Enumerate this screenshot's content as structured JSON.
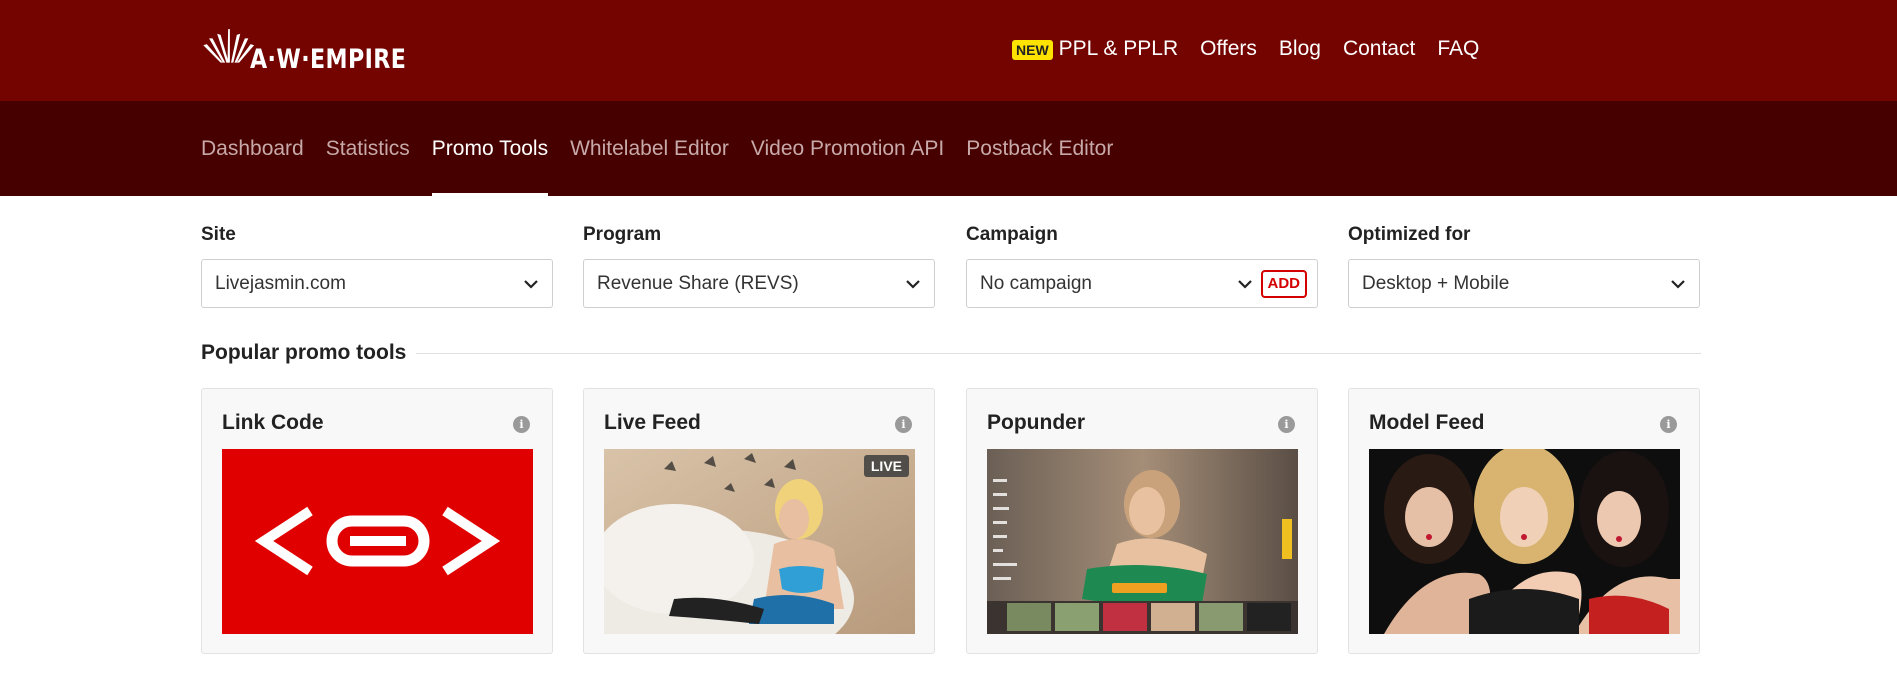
{
  "brand": {
    "logo_text": "A·W·EMPIRE",
    "colors": {
      "header": "#730400",
      "subnav": "#470000",
      "accent": "#d40000",
      "badge": "#ffe300"
    }
  },
  "topnav": {
    "new_badge": "NEW",
    "items": [
      {
        "label": "PPL & PPLR"
      },
      {
        "label": "Offers"
      },
      {
        "label": "Blog"
      },
      {
        "label": "Contact"
      },
      {
        "label": "FAQ"
      }
    ]
  },
  "subnav": {
    "tabs": [
      {
        "label": "Dashboard",
        "active": false
      },
      {
        "label": "Statistics",
        "active": false
      },
      {
        "label": "Promo Tools",
        "active": true
      },
      {
        "label": "Whitelabel Editor",
        "active": false
      },
      {
        "label": "Video Promotion API",
        "active": false
      },
      {
        "label": "Postback Editor",
        "active": false
      }
    ]
  },
  "filters": {
    "site": {
      "label": "Site",
      "value": "Livejasmin.com"
    },
    "program": {
      "label": "Program",
      "value": "Revenue Share (REVS)"
    },
    "campaign": {
      "label": "Campaign",
      "value": "No campaign",
      "add_label": "ADD"
    },
    "optimized": {
      "label": "Optimized for",
      "value": "Desktop + Mobile"
    }
  },
  "section": {
    "title": "Popular promo tools"
  },
  "cards": [
    {
      "title": "Link Code",
      "info": "i",
      "icon": "link-code-icon"
    },
    {
      "title": "Live Feed",
      "info": "i",
      "badge": "LIVE",
      "image": "live-feed-photo"
    },
    {
      "title": "Popunder",
      "info": "i",
      "image": "popunder-preview"
    },
    {
      "title": "Model Feed",
      "info": "i",
      "image": "model-feed-photo"
    }
  ]
}
